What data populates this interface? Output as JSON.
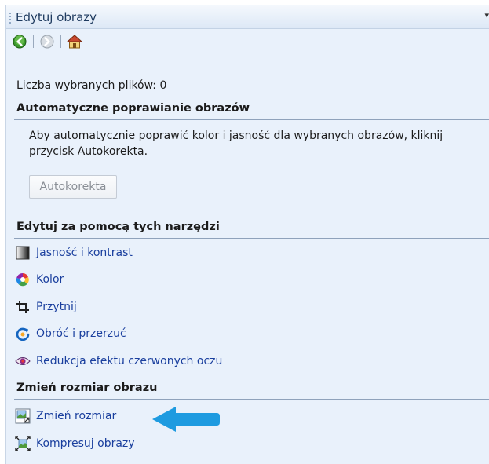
{
  "pane": {
    "title": "Edytuj obrazy",
    "menu_glyph": "▾"
  },
  "nav": {
    "back_icon": "back-arrow-icon",
    "forward_icon": "forward-arrow-icon",
    "home_icon": "home-icon"
  },
  "status": {
    "selected_files": "Liczba wybranych plików: 0"
  },
  "auto_section": {
    "title": "Automatyczne poprawianie obrazów",
    "description": "Aby automatycznie poprawić kolor i jasność dla wybranych obrazów, kliknij przycisk Autokorekta.",
    "button_label": "Autokorekta"
  },
  "tools_section": {
    "title": "Edytuj za pomocą tych narzędzi",
    "items": [
      {
        "label": "Jasność i kontrast",
        "icon": "brightness-contrast-icon"
      },
      {
        "label": "Kolor",
        "icon": "color-wheel-icon"
      },
      {
        "label": "Przytnij",
        "icon": "crop-icon"
      },
      {
        "label": "Obróć i przerzuć",
        "icon": "rotate-flip-icon"
      },
      {
        "label": "Redukcja efektu czerwonych oczu",
        "icon": "red-eye-icon"
      }
    ]
  },
  "resize_section": {
    "title": "Zmień rozmiar obrazu",
    "items": [
      {
        "label": "Zmień rozmiar",
        "icon": "resize-icon"
      },
      {
        "label": "Kompresuj obrazy",
        "icon": "compress-icon"
      }
    ]
  },
  "colors": {
    "link": "#1a3f9e",
    "pane_bg": "#e9f1fb",
    "arrow": "#1e9be0"
  }
}
